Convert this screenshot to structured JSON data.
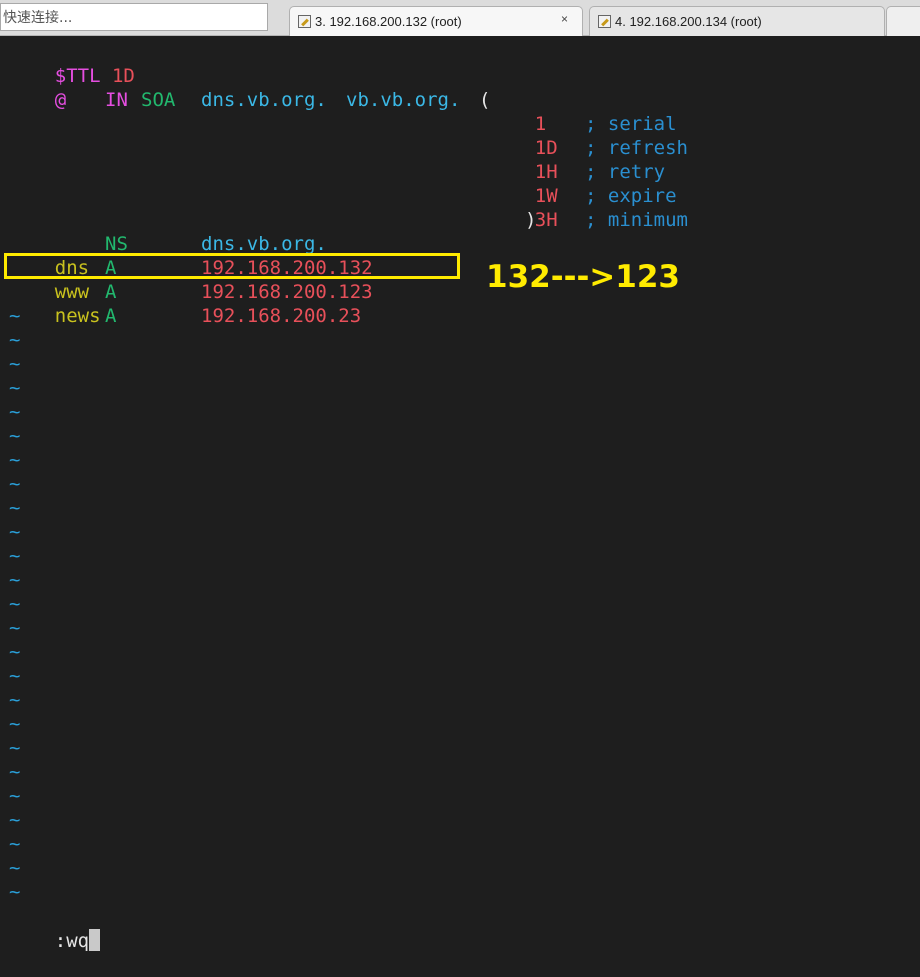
{
  "toolbar": {
    "quick_connect_placeholder": "快速连接..."
  },
  "tabs": [
    {
      "label": "3. 192.168.200.132 (root)",
      "active": true,
      "close": "×"
    },
    {
      "label": "4. 192.168.200.134 (root)",
      "active": false
    }
  ],
  "editor": {
    "l1": {
      "ttl": "$TTL",
      "val": "1D"
    },
    "l2": {
      "at": "@",
      "in": "IN",
      "soa": "SOA",
      "ns": "dns.vb.org.",
      "mail": "vb.vb.org.",
      "paren": "("
    },
    "soa_fields": [
      {
        "value": "1",
        "comment": "; serial"
      },
      {
        "value": "1D",
        "comment": "; refresh"
      },
      {
        "value": "1H",
        "comment": "; retry"
      },
      {
        "value": "1W",
        "comment": "; expire"
      },
      {
        "value": "3H",
        "close": ")",
        "comment": "; minimum"
      }
    ],
    "ns_record": {
      "type": "NS",
      "target": "dns.vb.org."
    },
    "records": [
      {
        "name": "dns",
        "type": "A",
        "ip": "192.168.200.132"
      },
      {
        "name": "www",
        "type": "A",
        "ip": "192.168.200.123"
      },
      {
        "name": "news",
        "type": "A",
        "ip": "192.168.200.23"
      }
    ],
    "tilde": "~",
    "command": ":wq"
  },
  "annotation": {
    "text": "132--->123",
    "color": "#ffeb00"
  },
  "colors": {
    "background": "#1e1e1e",
    "keyword": "#e54ee0",
    "number": "#e8505a",
    "type": "#22b86e",
    "domain": "#3bb8e6",
    "name": "#c9c21e",
    "highlight": "#ffeb00"
  }
}
